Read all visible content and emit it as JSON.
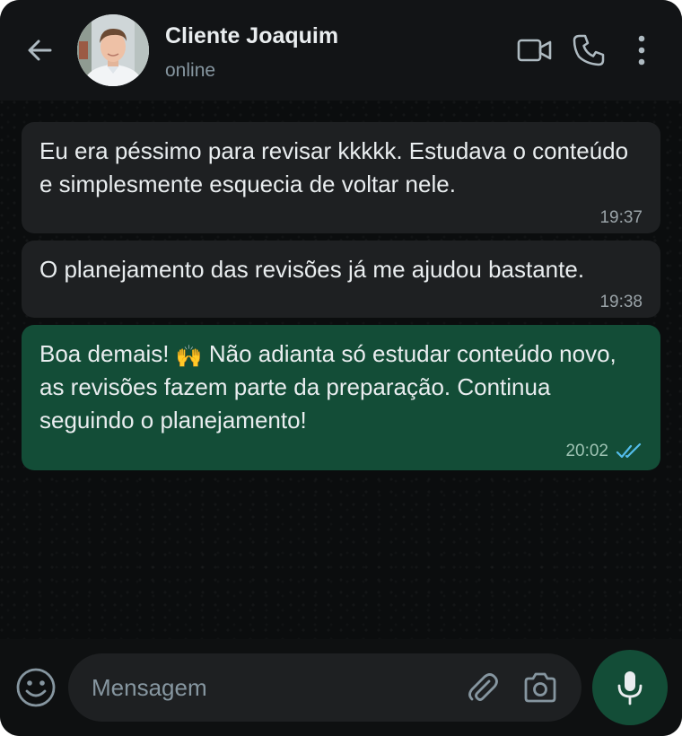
{
  "header": {
    "contact_name": "Cliente Joaquim",
    "status": "online"
  },
  "icons": {
    "back": "arrow-left-icon",
    "video_call": "video-camera-icon",
    "voice_call": "phone-icon",
    "menu": "more-vertical-icon",
    "emoji": "emoji-smile-icon",
    "attach": "paperclip-icon",
    "camera": "camera-icon",
    "mic": "microphone-icon"
  },
  "messages": [
    {
      "direction": "incoming",
      "text": "Eu era péssimo para revisar kkkkk. Estudava o conteúdo e simplesmente esquecia de voltar nele.",
      "time": "19:37"
    },
    {
      "direction": "incoming",
      "text": "O planejamento das revisões já me ajudou bastante.",
      "time": "19:38"
    },
    {
      "direction": "outgoing",
      "text_before_emoji": "Boa demais!",
      "emoji": "🙌",
      "text_after_emoji": "Não adianta só estudar conteúdo novo, as revisões fazem parte da preparação. Continua seguindo o planejamento!",
      "time": "20:02",
      "read": true
    }
  ],
  "composer": {
    "placeholder": "Mensagem",
    "value": ""
  },
  "colors": {
    "background": "#0b0d0e",
    "header": "#121416",
    "incoming_bubble": "#1e2022",
    "outgoing_bubble": "#134d37",
    "read_ticks": "#53bdeb",
    "secondary_text": "#8696a0"
  }
}
